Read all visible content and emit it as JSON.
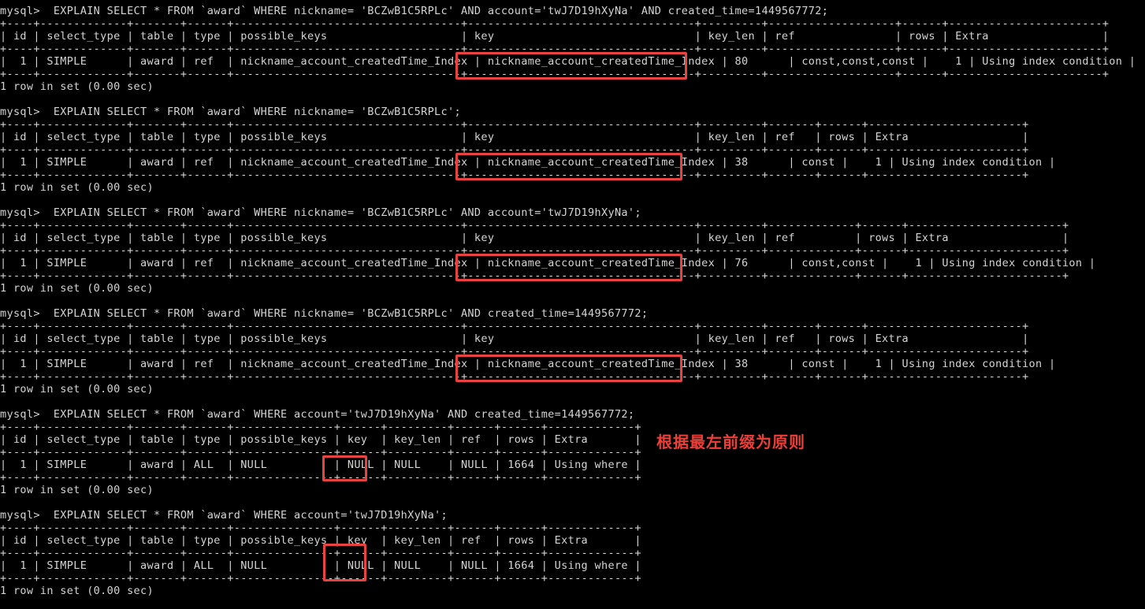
{
  "terminal": {
    "prompt": "mysql>",
    "status_line": "1 row in set (0.00 sec)",
    "background_color": "#000000",
    "text_color": "#d4d4d4",
    "highlight_color": "#e8433f",
    "annotation_color": "#ef3e36"
  },
  "annotation": {
    "text": "根据最左前缀为原则"
  },
  "blocks": [
    {
      "id": "block-1",
      "command": "mysql>  EXPLAIN SELECT * FROM `award` WHERE nickname= 'BCZwB1C5RPLc' AND account='twJ7D19hXyNa' AND created_time=1449567772;",
      "rule": "+----+-------------+-------+------+----------------------------------+----------------------------------+---------+-------------------+------+-----------------------+",
      "header": "| id | select_type | table | type | possible_keys                    | key                              | key_len | ref               | rows | Extra                 |",
      "row": "|  1 | SIMPLE      | award | ref  | nickname_account_createdTime_Index | nickname_account_createdTime_Index | 80      | const,const,const |    1 | Using index condition |",
      "status": "1 row in set (0.00 sec)",
      "cells": {
        "id": "1",
        "select_type": "SIMPLE",
        "table": "award",
        "type": "ref",
        "possible_keys": "nickname_account_createdTime_Index",
        "key": "nickname_account_createdTime_Index",
        "key_len": "80",
        "ref": "const,const,const",
        "rows": "1",
        "extra": "Using index condition"
      },
      "headers": [
        "id",
        "select_type",
        "table",
        "type",
        "possible_keys",
        "key",
        "key_len",
        "ref",
        "rows",
        "Extra"
      ],
      "highlight": "key-value"
    },
    {
      "id": "block-2",
      "command": "mysql>  EXPLAIN SELECT * FROM `award` WHERE nickname= 'BCZwB1C5RPLc';",
      "status": "1 row in set (0.00 sec)",
      "cells": {
        "id": "1",
        "select_type": "SIMPLE",
        "table": "award",
        "type": "ref",
        "possible_keys": "nickname_account_createdTime_Index",
        "key": "nickname_account_createdTime_Index",
        "key_len": "38",
        "ref": "const",
        "rows": "1",
        "extra": "Using index condition"
      },
      "headers": [
        "id",
        "select_type",
        "table",
        "type",
        "possible_keys",
        "key",
        "key_len",
        "ref",
        "rows",
        "Extra"
      ],
      "highlight": "key-value"
    },
    {
      "id": "block-3",
      "command": "mysql>  EXPLAIN SELECT * FROM `award` WHERE nickname= 'BCZwB1C5RPLc' AND account='twJ7D19hXyNa';",
      "status": "1 row in set (0.00 sec)",
      "cells": {
        "id": "1",
        "select_type": "SIMPLE",
        "table": "award",
        "type": "ref",
        "possible_keys": "nickname_account_createdTime_Index",
        "key": "nickname_account_createdTime_Index",
        "key_len": "76",
        "ref": "const,const",
        "rows": "1",
        "extra": "Using index condition"
      },
      "headers": [
        "id",
        "select_type",
        "table",
        "type",
        "possible_keys",
        "key",
        "key_len",
        "ref",
        "rows",
        "Extra"
      ],
      "highlight": "key-value"
    },
    {
      "id": "block-4",
      "command": "mysql>  EXPLAIN SELECT * FROM `award` WHERE nickname= 'BCZwB1C5RPLc' AND created_time=1449567772;",
      "status": "1 row in set (0.00 sec)",
      "cells": {
        "id": "1",
        "select_type": "SIMPLE",
        "table": "award",
        "type": "ref",
        "possible_keys": "nickname_account_createdTime_Index",
        "key": "nickname_account_createdTime_Index",
        "key_len": "38",
        "ref": "const",
        "rows": "1",
        "extra": "Using index condition"
      },
      "headers": [
        "id",
        "select_type",
        "table",
        "type",
        "possible_keys",
        "key",
        "key_len",
        "ref",
        "rows",
        "Extra"
      ],
      "highlight": "key-value"
    },
    {
      "id": "block-5",
      "command": "mysql>  EXPLAIN SELECT * FROM `award` WHERE account='twJ7D19hXyNa' AND created_time=1449567772;",
      "status": "1 row in set (0.00 sec)",
      "cells": {
        "id": "1",
        "select_type": "SIMPLE",
        "table": "award",
        "type": "ALL",
        "possible_keys": "NULL",
        "key": "NULL",
        "key_len": "NULL",
        "ref": "NULL",
        "rows": "1664",
        "extra": "Using where"
      },
      "headers": [
        "id",
        "select_type",
        "table",
        "type",
        "possible_keys",
        "key",
        "key_len",
        "ref",
        "rows",
        "Extra"
      ],
      "highlight": "key-value"
    },
    {
      "id": "block-6",
      "command": "mysql>  EXPLAIN SELECT * FROM `award` WHERE account='twJ7D19hXyNa';",
      "status": "1 row in set (0.00 sec)",
      "cells": {
        "id": "1",
        "select_type": "SIMPLE",
        "table": "award",
        "type": "ALL",
        "possible_keys": "NULL",
        "key": "NULL",
        "key_len": "NULL",
        "ref": "NULL",
        "rows": "1664",
        "extra": "Using where"
      },
      "headers": [
        "id",
        "select_type",
        "table",
        "type",
        "possible_keys",
        "key",
        "key_len",
        "ref",
        "rows",
        "Extra"
      ],
      "highlight": "key-header-and-value"
    }
  ],
  "lines": {
    "b1_cmd": "mysql>  EXPLAIN SELECT * FROM `award` WHERE nickname= 'BCZwB1C5RPLc' AND account='twJ7D19hXyNa' AND created_time=1449567772;",
    "b1_top": "+----+-------------+-------+------+----------------------------------+----------------------------------+---------+-------------------+------+-----------------------+",
    "b1_hdr": "| id | select_type | table | type | possible_keys                    | key                              | key_len | ref               | rows | Extra                 |",
    "b1_mid": "+----+-------------+-------+------+----------------------------------+----------------------------------+---------+-------------------+------+-----------------------+",
    "b1_row": "|  1 | SIMPLE      | award | ref  | nickname_account_createdTime_Index | nickname_account_createdTime_Index | 80      | const,const,const |    1 | Using index condition |",
    "b1_bot": "+----+-------------+-------+------+----------------------------------+----------------------------------+---------+-------------------+------+-----------------------+",
    "b1_st": "1 row in set (0.00 sec)",
    "b2_cmd": "mysql>  EXPLAIN SELECT * FROM `award` WHERE nickname= 'BCZwB1C5RPLc';",
    "b2_top": "+----+-------------+-------+------+----------------------------------+----------------------------------+---------+-------+------+-----------------------+",
    "b2_hdr": "| id | select_type | table | type | possible_keys                    | key                              | key_len | ref   | rows | Extra                 |",
    "b2_mid": "+----+-------------+-------+------+----------------------------------+----------------------------------+---------+-------+------+-----------------------+",
    "b2_row": "|  1 | SIMPLE      | award | ref  | nickname_account_createdTime_Index | nickname_account_createdTime_Index | 38      | const |    1 | Using index condition |",
    "b2_bot": "+----+-------------+-------+------+----------------------------------+----------------------------------+---------+-------+------+-----------------------+",
    "b2_st": "1 row in set (0.00 sec)",
    "b3_cmd": "mysql>  EXPLAIN SELECT * FROM `award` WHERE nickname= 'BCZwB1C5RPLc' AND account='twJ7D19hXyNa';",
    "b3_top": "+----+-------------+-------+------+----------------------------------+----------------------------------+---------+-------------+------+-----------------------+",
    "b3_hdr": "| id | select_type | table | type | possible_keys                    | key                              | key_len | ref         | rows | Extra                 |",
    "b3_mid": "+----+-------------+-------+------+----------------------------------+----------------------------------+---------+-------------+------+-----------------------+",
    "b3_row": "|  1 | SIMPLE      | award | ref  | nickname_account_createdTime_Index | nickname_account_createdTime_Index | 76      | const,const |    1 | Using index condition |",
    "b3_bot": "+----+-------------+-------+------+----------------------------------+----------------------------------+---------+-------------+------+-----------------------+",
    "b3_st": "1 row in set (0.00 sec)",
    "b4_cmd": "mysql>  EXPLAIN SELECT * FROM `award` WHERE nickname= 'BCZwB1C5RPLc' AND created_time=1449567772;",
    "b4_top": "+----+-------------+-------+------+----------------------------------+----------------------------------+---------+-------+------+-----------------------+",
    "b4_hdr": "| id | select_type | table | type | possible_keys                    | key                              | key_len | ref   | rows | Extra                 |",
    "b4_mid": "+----+-------------+-------+------+----------------------------------+----------------------------------+---------+-------+------+-----------------------+",
    "b4_row": "|  1 | SIMPLE      | award | ref  | nickname_account_createdTime_Index | nickname_account_createdTime_Index | 38      | const |    1 | Using index condition |",
    "b4_bot": "+----+-------------+-------+------+----------------------------------+----------------------------------+---------+-------+------+-----------------------+",
    "b4_st": "1 row in set (0.00 sec)",
    "b5_cmd": "mysql>  EXPLAIN SELECT * FROM `award` WHERE account='twJ7D19hXyNa' AND created_time=1449567772;",
    "b5_top": "+----+-------------+-------+------+---------------+------+---------+------+------+-------------+",
    "b5_hdr": "| id | select_type | table | type | possible_keys | key  | key_len | ref  | rows | Extra       |",
    "b5_mid": "+----+-------------+-------+------+---------------+------+---------+------+------+-------------+",
    "b5_row": "|  1 | SIMPLE      | award | ALL  | NULL          | NULL | NULL    | NULL | 1664 | Using where |",
    "b5_bot": "+----+-------------+-------+------+---------------+------+---------+------+------+-------------+",
    "b5_st": "1 row in set (0.00 sec)",
    "b6_cmd": "mysql>  EXPLAIN SELECT * FROM `award` WHERE account='twJ7D19hXyNa';",
    "b6_top": "+----+-------------+-------+------+---------------+------+---------+------+------+-------------+",
    "b6_hdr": "| id | select_type | table | type | possible_keys | key  | key_len | ref  | rows | Extra       |",
    "b6_mid": "+----+-------------+-------+------+---------------+------+---------+------+------+-------------+",
    "b6_row": "|  1 | SIMPLE      | award | ALL  | NULL          | NULL | NULL    | NULL | 1664 | Using where |",
    "b6_bot": "+----+-------------+-------+------+---------------+------+---------+------+------+-------------+",
    "b6_st": "1 row in set (0.00 sec)"
  }
}
